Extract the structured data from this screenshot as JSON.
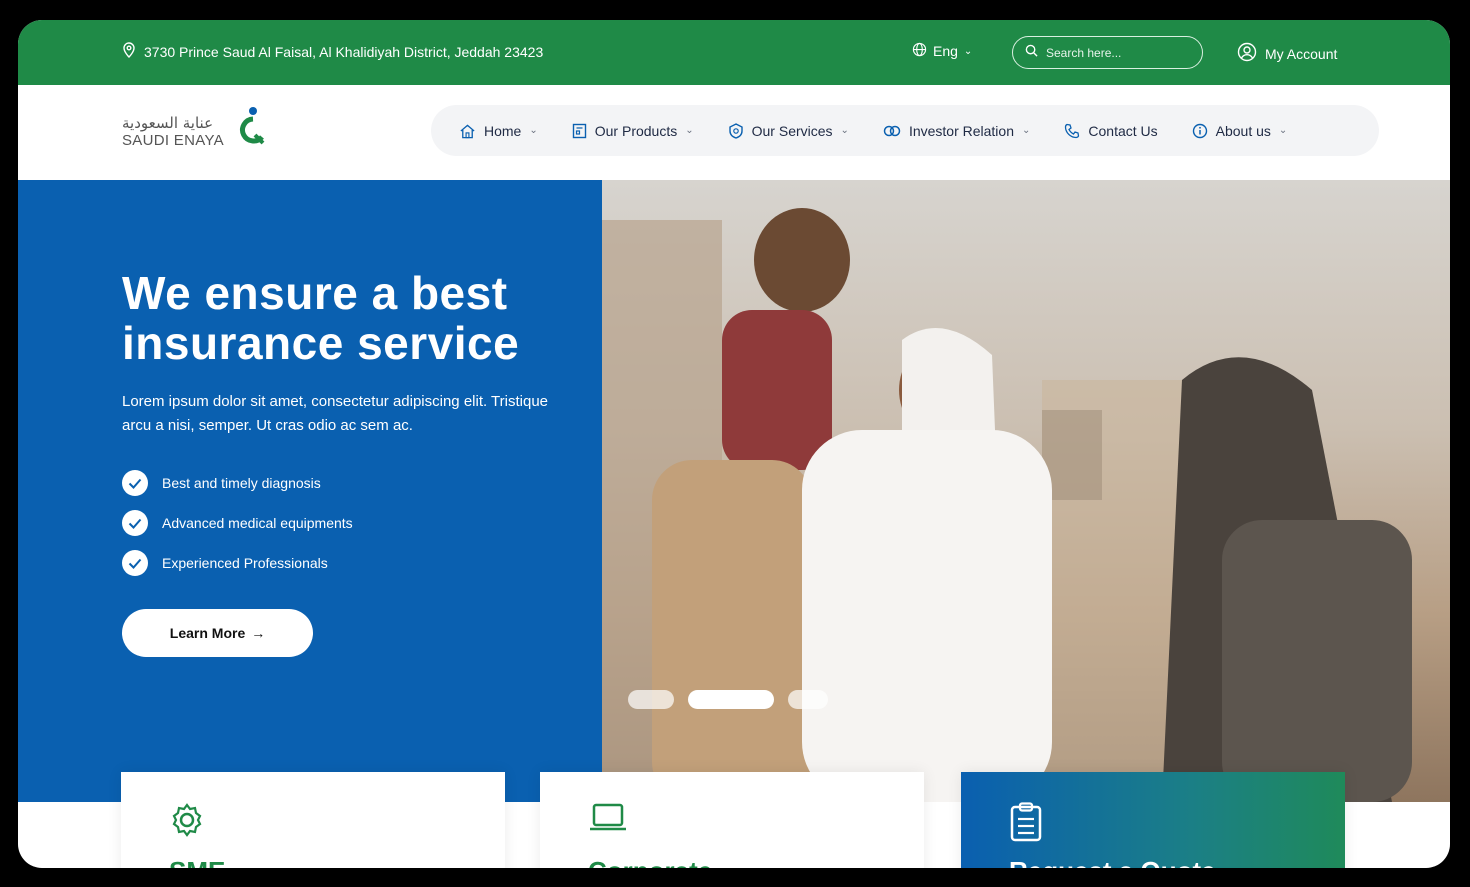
{
  "topbar": {
    "address": "3730 Prince Saud Al Faisal, Al Khalidiyah District, Jeddah 23423",
    "language": "Eng",
    "search_placeholder": "Search here...",
    "account": "My Account"
  },
  "logo": {
    "arabic": "عناية السعودية",
    "english": "SAUDI ENAYA"
  },
  "nav": [
    {
      "label": "Home",
      "icon": "home-icon",
      "dropdown": true
    },
    {
      "label": "Our Products",
      "icon": "products-icon",
      "dropdown": true
    },
    {
      "label": "Our Services",
      "icon": "services-icon",
      "dropdown": true
    },
    {
      "label": "Investor Relation",
      "icon": "investor-icon",
      "dropdown": true
    },
    {
      "label": "Contact Us",
      "icon": "phone-icon",
      "dropdown": false
    },
    {
      "label": "About us",
      "icon": "info-icon",
      "dropdown": true
    }
  ],
  "hero": {
    "title": "We ensure a best insurance service",
    "description": "Lorem ipsum dolor sit amet, consectetur adipiscing elit. Tristique arcu a nisi, semper. Ut cras odio ac sem ac.",
    "features": [
      "Best and timely diagnosis",
      "Advanced medical equipments",
      "Experienced Professionals"
    ],
    "cta": "Learn More"
  },
  "cards": [
    {
      "title": "SME",
      "icon": "gear-icon"
    },
    {
      "title": "Corporate",
      "icon": "laptop-icon"
    },
    {
      "title": "Request a Quote",
      "icon": "clipboard-icon"
    }
  ],
  "colors": {
    "green": "#1f8a47",
    "blue": "#0a60b0"
  }
}
